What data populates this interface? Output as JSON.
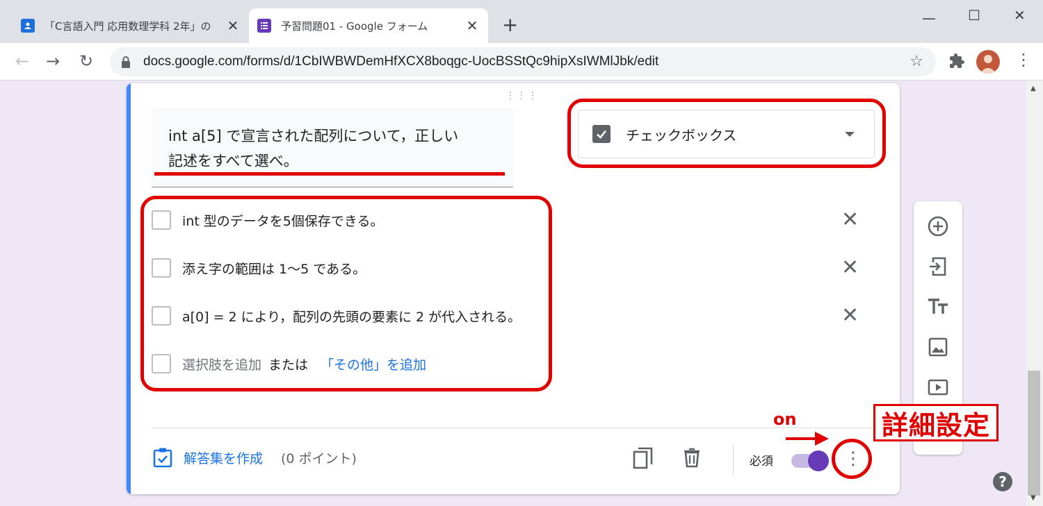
{
  "browser": {
    "tabs": [
      {
        "title": "「C言語入門 応用数理学科 2年」の",
        "icon": "classroom-icon",
        "active": false
      },
      {
        "title": "予習問題01 - Google フォーム",
        "icon": "forms-icon",
        "active": true
      }
    ],
    "url": "docs.google.com/forms/d/1CbIWBWDemHfXCX8boqgc-UocBSStQc9hipXsIWMlJbk/edit"
  },
  "question": {
    "line1": "int a[5] で宣言された配列について，正しい",
    "line2": "記述をすべて選べ。",
    "type_label": "チェックボックス"
  },
  "options": [
    {
      "label": "int 型のデータを5個保存できる。"
    },
    {
      "label": "添え字の範囲は 1〜5 である。"
    },
    {
      "label": "a[0] = 2 により，配列の先頭の要素に 2 が代入される。"
    }
  ],
  "add_option": {
    "placeholder": "選択肢を追加",
    "or": "または",
    "other_link": "「その他」を追加"
  },
  "footer": {
    "answer_key": "解答集を作成",
    "points": "(0 ポイント)",
    "required_label": "必須",
    "required_on": true
  },
  "annotations": {
    "on_label": "on",
    "settings_label": "詳細設定",
    "color": "#e00000"
  },
  "colors": {
    "accent_blue": "#4285f4",
    "forms_purple": "#673ab7",
    "link_blue": "#1a73e8"
  }
}
